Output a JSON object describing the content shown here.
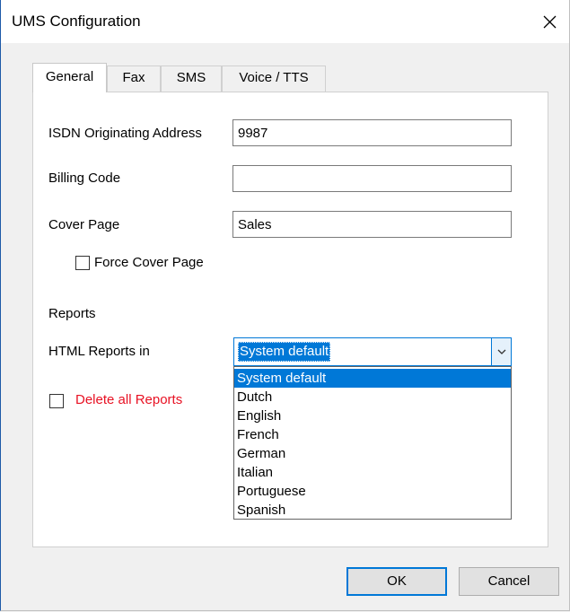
{
  "window": {
    "title": "UMS Configuration"
  },
  "tabs": [
    {
      "label": "General",
      "active": true
    },
    {
      "label": "Fax",
      "active": false
    },
    {
      "label": "SMS",
      "active": false
    },
    {
      "label": "Voice / TTS",
      "active": false
    }
  ],
  "general": {
    "isdn_label": "ISDN Originating Address",
    "isdn_value": "9987",
    "billing_label": "Billing Code",
    "billing_value": "",
    "cover_label": "Cover Page",
    "cover_value": "Sales",
    "force_cover_label": "Force Cover Page",
    "force_cover_checked": false,
    "reports_heading": "Reports",
    "html_reports_label": "HTML Reports in",
    "html_reports_selected": "System default",
    "html_reports_options": [
      "System default",
      "Dutch",
      "English",
      "French",
      "German",
      "Italian",
      "Portuguese",
      "Spanish"
    ],
    "delete_reports_label": "Delete all Reports",
    "delete_reports_checked": false,
    "delete_reports_color": "#e81123"
  },
  "buttons": {
    "ok": "OK",
    "cancel": "Cancel"
  },
  "colors": {
    "accent": "#0078d7"
  },
  "icons": {
    "close": "close-icon",
    "dropdown": "chevron-down-icon"
  }
}
